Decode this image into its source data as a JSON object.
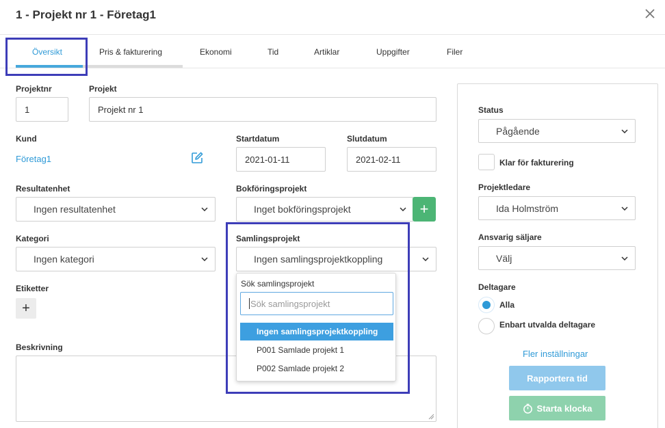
{
  "header": {
    "title": "1 - Projekt nr 1 - Företag1"
  },
  "tabs": [
    {
      "label": "Översikt",
      "active": true
    },
    {
      "label": "Pris & fakturering",
      "active": false
    },
    {
      "label": "Ekonomi",
      "active": false
    },
    {
      "label": "Tid",
      "active": false
    },
    {
      "label": "Artiklar",
      "active": false
    },
    {
      "label": "Uppgifter",
      "active": false
    },
    {
      "label": "Filer",
      "active": false
    }
  ],
  "form": {
    "projektnr_label": "Projektnr",
    "projektnr_value": "1",
    "projekt_label": "Projekt",
    "projekt_value": "Projekt nr 1",
    "kund_label": "Kund",
    "kund_value": "Företag1",
    "startdatum_label": "Startdatum",
    "startdatum_value": "2021-01-11",
    "slutdatum_label": "Slutdatum",
    "slutdatum_value": "2021-02-11",
    "resultatenhet_label": "Resultatenhet",
    "resultatenhet_value": "Ingen resultatenhet",
    "bokforingsprojekt_label": "Bokföringsprojekt",
    "bokforingsprojekt_value": "Inget bokföringsprojekt",
    "kategori_label": "Kategori",
    "kategori_value": "Ingen kategori",
    "samlingsprojekt_label": "Samlingsprojekt",
    "samlingsprojekt_value": "Ingen samlingsprojektkoppling",
    "etiketter_label": "Etiketter",
    "beskrivning_label": "Beskrivning",
    "add_symbol": "+"
  },
  "dropdown": {
    "label": "Sök samlingsprojekt",
    "search_placeholder": "Sök samlingsprojekt",
    "options": [
      {
        "label": "Ingen samlingsprojektkoppling",
        "selected": true
      },
      {
        "label": "P001 Samlade projekt 1",
        "selected": false
      },
      {
        "label": "P002 Samlade projekt 2",
        "selected": false
      }
    ]
  },
  "sidebar": {
    "status_label": "Status",
    "status_value": "Pågående",
    "klar_label": "Klar för fakturering",
    "projektledare_label": "Projektledare",
    "projektledare_value": "Ida Holmström",
    "saljare_label": "Ansvarig säljare",
    "saljare_value": "Välj",
    "deltagare_label": "Deltagare",
    "deltagare_options": [
      {
        "label": "Alla",
        "selected": true
      },
      {
        "label": "Enbart utvalda deltagare",
        "selected": false
      }
    ],
    "fler_link": "Fler inställningar",
    "rapportera_button": "Rapportera tid",
    "starta_button": "Starta klocka"
  },
  "colors": {
    "accent": "#2f9ad7",
    "highlight_border": "#3d3db8",
    "green": "#4cb575"
  }
}
